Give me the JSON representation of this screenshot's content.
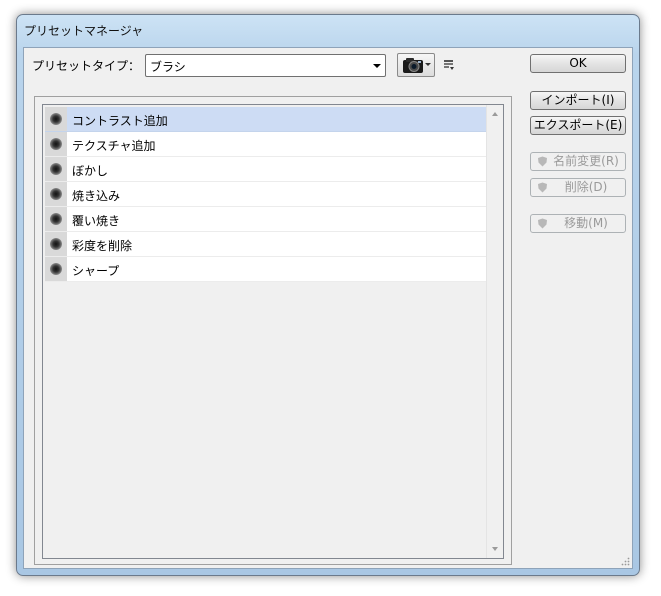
{
  "window": {
    "title": "プリセットマネージャ"
  },
  "preset_type": {
    "label": "プリセットタイプ：",
    "selected": "ブラシ"
  },
  "toolbar": {
    "camera_icon": "camera-icon",
    "menu_icon": "panel-menu-icon"
  },
  "buttons": {
    "ok": "OK",
    "import": "インポート(I)",
    "export": "エクスポート(E)",
    "rename": "名前変更(R)",
    "delete": "削除(D)",
    "move": "移動(M)"
  },
  "presets": [
    {
      "label": "コントラスト追加"
    },
    {
      "label": "テクスチャ追加"
    },
    {
      "label": "ぼかし"
    },
    {
      "label": "焼き込み"
    },
    {
      "label": "覆い焼き"
    },
    {
      "label": "彩度を削除"
    },
    {
      "label": "シャープ"
    }
  ],
  "selected_index": 0,
  "colors": {
    "selection": "#cddcf4",
    "frame": "#b9d4ec"
  }
}
